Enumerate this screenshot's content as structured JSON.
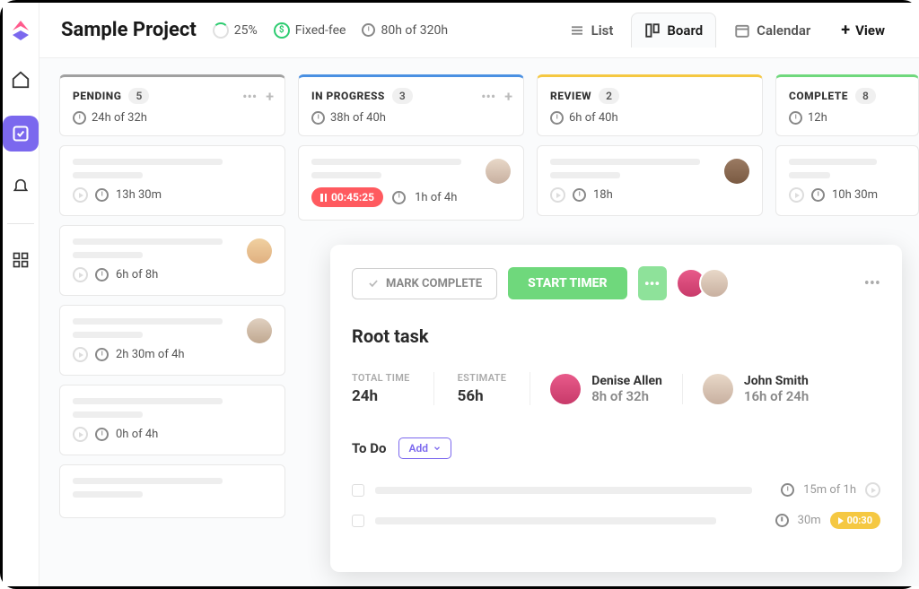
{
  "project": {
    "title": "Sample Project",
    "progress": "25%",
    "billing": "Fixed-fee",
    "hours": "80h of 320h"
  },
  "views": {
    "list": "List",
    "board": "Board",
    "calendar": "Calendar",
    "add": "View"
  },
  "columns": [
    {
      "key": "pending",
      "title": "PENDING",
      "count": "5",
      "time": "24h of 32h",
      "cls": "pending"
    },
    {
      "key": "progress",
      "title": "IN PROGRESS",
      "count": "3",
      "time": "38h of 40h",
      "cls": "progress"
    },
    {
      "key": "review",
      "title": "REVIEW",
      "count": "2",
      "time": "6h of 40h",
      "cls": "review"
    },
    {
      "key": "complete",
      "title": "COMPLETE",
      "count": "8",
      "time": "12h",
      "cls": "complete"
    }
  ],
  "pending_cards": [
    {
      "time": "13h 30m"
    },
    {
      "time": "6h of 8h",
      "avatar": "#e8c49a"
    },
    {
      "time": "2h 30m of 4h",
      "avatar": "#d4c4b0"
    },
    {
      "time": "0h of 4h"
    },
    {
      "time": ""
    }
  ],
  "progress_card": {
    "timer": "00:45:25",
    "time": "1h of 4h",
    "avatar": "#d8c8b8"
  },
  "review_card": {
    "time": "18h",
    "avatar": "#8a6a52"
  },
  "complete_card": {
    "time": "10h 30m"
  },
  "task_panel": {
    "mark_complete": "MARK COMPLETE",
    "start_timer": "START TIMER",
    "title": "Root task",
    "total_label": "TOTAL TIME",
    "total_value": "24h",
    "estimate_label": "ESTIMATE",
    "estimate_value": "56h",
    "members": [
      {
        "name": "Denise Allen",
        "time": "8h of 32h",
        "color": "#d44a6a"
      },
      {
        "name": "John Smith",
        "time": "16h of 24h",
        "color": "#d8c8b8"
      }
    ],
    "todo_label": "To Do",
    "add_label": "Add",
    "todo_items": [
      {
        "meta": "15m of 1h",
        "chip": null
      },
      {
        "meta": "30m",
        "chip": "00:30"
      }
    ]
  }
}
